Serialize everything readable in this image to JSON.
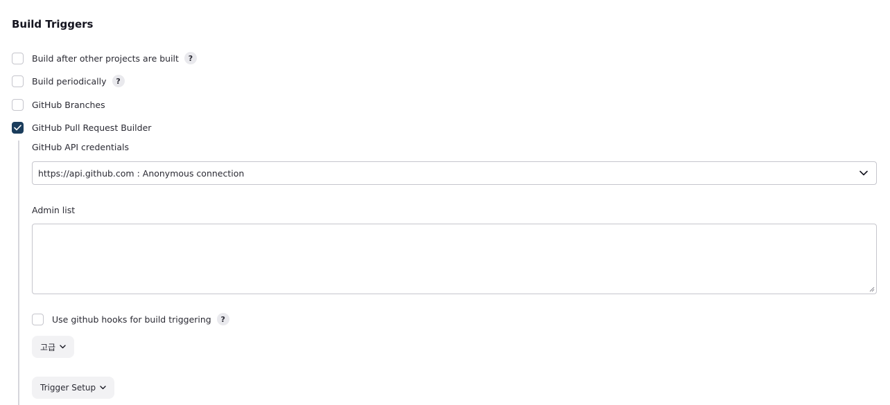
{
  "section": {
    "title": "Build Triggers"
  },
  "triggers": [
    {
      "label": "Build after other projects are built",
      "checked": false,
      "help": "?"
    },
    {
      "label": "Build periodically",
      "checked": false,
      "help": "?"
    },
    {
      "label": "GitHub Branches",
      "checked": false
    },
    {
      "label": "GitHub Pull Request Builder",
      "checked": true
    }
  ],
  "pr_builder": {
    "credentials_label": "GitHub API credentials",
    "credentials_value": "https://api.github.com : Anonymous connection",
    "admin_list_label": "Admin list",
    "admin_list_value": "",
    "hooks_label": "Use github hooks for build triggering",
    "hooks_checked": false,
    "hooks_help": "?",
    "advanced_button": "고급",
    "trigger_setup_button": "Trigger Setup"
  },
  "icons": {
    "check": "check-icon",
    "help": "help-icon",
    "dropdown": "chevron-down-icon"
  },
  "colors": {
    "checked_bg": "#1b3d5c",
    "border": "#c5c5cc",
    "help_bg": "#e9e9ed",
    "button_bg": "#f2f2f4"
  }
}
